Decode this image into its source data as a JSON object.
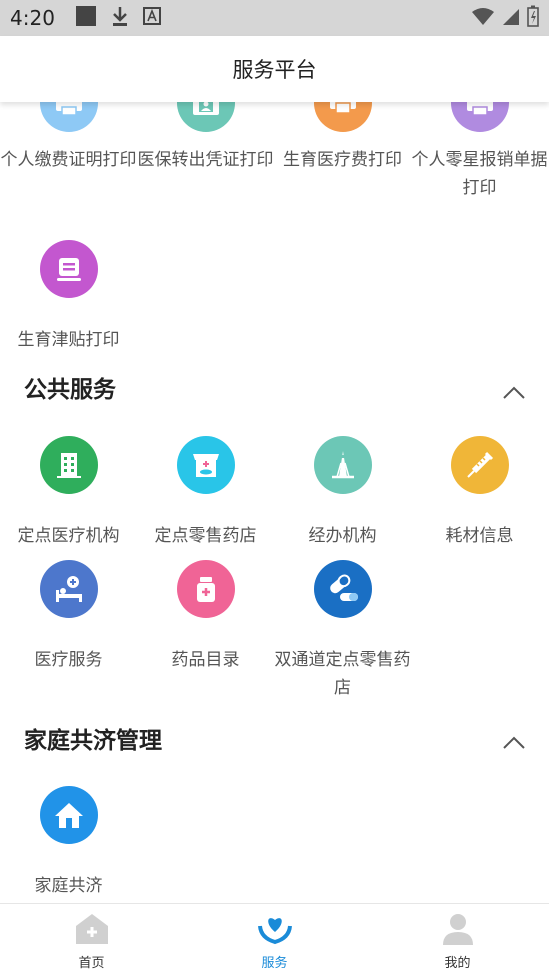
{
  "status_bar": {
    "time": "4:20"
  },
  "header": {
    "title": "服务平台"
  },
  "print_items": [
    {
      "label": "个人缴费证明打印",
      "color": "#8ec9f5",
      "icon": "printer-icon"
    },
    {
      "label": "医保转出凭证打印",
      "color": "#6cc7b6",
      "icon": "printer-photo-icon"
    },
    {
      "label": "生育医疗费打印",
      "color": "#f39a4c",
      "icon": "printer-icon"
    },
    {
      "label": "个人零星报销单据打印",
      "color": "#b08be0",
      "icon": "printer-icon"
    },
    {
      "label": "生育津贴打印",
      "color": "#c357cf",
      "icon": "document-stack-icon"
    }
  ],
  "public_services": {
    "title": "公共服务",
    "items": [
      {
        "label": "定点医疗机构",
        "color": "#2fae5c",
        "icon": "building-icon"
      },
      {
        "label": "定点零售药店",
        "color": "#29c5e8",
        "icon": "pharmacy-store-icon"
      },
      {
        "label": "经办机构",
        "color": "#6cc7b6",
        "icon": "tower-icon"
      },
      {
        "label": "耗材信息",
        "color": "#f0b638",
        "icon": "syringe-icon"
      },
      {
        "label": "医疗服务",
        "color": "#4d77cc",
        "icon": "hospital-bed-icon"
      },
      {
        "label": "药品目录",
        "color": "#f06496",
        "icon": "medicine-bottle-icon"
      },
      {
        "label": "双通道定点零售药店",
        "color": "#1a6fc4",
        "icon": "capsule-icon"
      }
    ]
  },
  "family": {
    "title": "家庭共济管理",
    "items": [
      {
        "label": "家庭共济",
        "color": "#2193e8",
        "icon": "house-icon"
      }
    ]
  },
  "bottom_nav": [
    {
      "label": "首页",
      "icon": "home-icon"
    },
    {
      "label": "服务",
      "icon": "service-heart-icon",
      "active": true
    },
    {
      "label": "我的",
      "icon": "profile-icon"
    }
  ],
  "colors": {
    "accent": "#1a8bd8",
    "inactive_icon": "#d0d0d0"
  }
}
